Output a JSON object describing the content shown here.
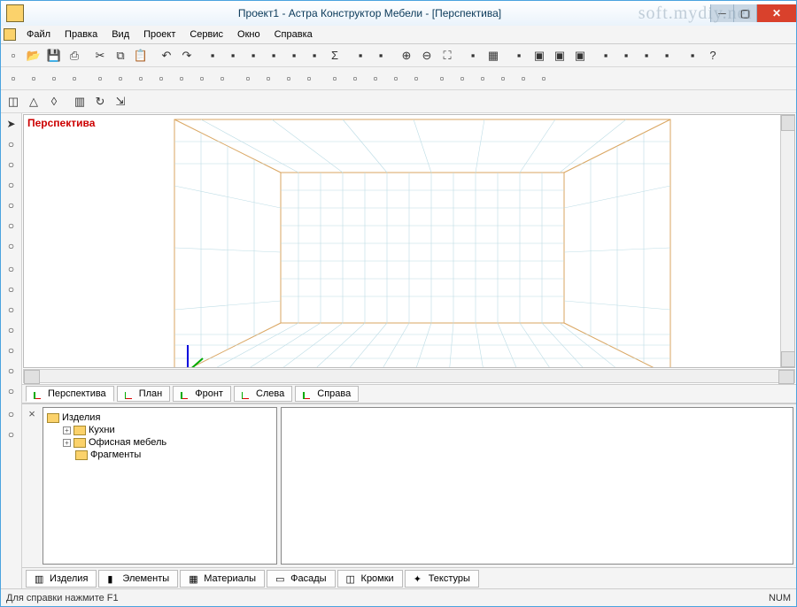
{
  "title": "Проект1 - Астра Конструктор Мебели - [Перспектива]",
  "watermark": "soft.mydiy.net",
  "menu": [
    "Файл",
    "Правка",
    "Вид",
    "Проект",
    "Сервис",
    "Окно",
    "Справка"
  ],
  "viewport_label": "Перспектива",
  "view_tabs": [
    "Перспектива",
    "План",
    "Фронт",
    "Слева",
    "Справа"
  ],
  "tree": {
    "root": "Изделия",
    "children": [
      {
        "label": "Кухни",
        "expandable": true
      },
      {
        "label": "Офисная мебель",
        "expandable": true
      },
      {
        "label": "Фрагменты",
        "expandable": false
      }
    ]
  },
  "bottom_tabs": [
    "Изделия",
    "Элементы",
    "Материалы",
    "Фасады",
    "Кромки",
    "Текстуры"
  ],
  "status_left": "Для справки нажмите F1",
  "status_right": "NUM",
  "toolbar1_icons": [
    "new-icon",
    "open-icon",
    "save-icon",
    "print-icon",
    "sep",
    "cut-icon",
    "copy-icon",
    "paste-icon",
    "sep",
    "undo-icon",
    "redo-icon",
    "sep",
    "item-icon",
    "item-icon",
    "item-icon",
    "item-icon",
    "item-icon",
    "item-icon",
    "sum-icon",
    "sep",
    "item-icon",
    "item-icon",
    "sep",
    "zoom-in-icon",
    "zoom-out-icon",
    "zoom-fit-icon",
    "sep",
    "item-icon",
    "grid-icon",
    "sep",
    "item-icon",
    "box-icon",
    "box-icon",
    "box-icon",
    "sep",
    "item-icon",
    "item-icon",
    "item-icon",
    "item-icon",
    "sep",
    "item-icon",
    "help-icon"
  ],
  "toolbar2_icons": [
    "t2",
    "t2",
    "t2",
    "t2",
    "sep",
    "t2",
    "t2",
    "t2",
    "t2",
    "t2",
    "t2",
    "t2",
    "sep",
    "t2",
    "t2",
    "t2",
    "t2",
    "sep",
    "t2",
    "t2",
    "t2",
    "t2",
    "t2",
    "sep",
    "t2",
    "t2",
    "t2",
    "t2",
    "t2",
    "t2"
  ],
  "toolbar3_icons": [
    "cube-icon",
    "prism-icon",
    "drop-icon",
    "sep",
    "panel-icon",
    "rot-icon",
    "ext-icon"
  ],
  "side_icons": [
    "arrow-icon",
    "i",
    "i",
    "i",
    "i",
    "i",
    "i",
    "sep",
    "i",
    "i",
    "i",
    "i",
    "i",
    "i",
    "i",
    "sep",
    "i",
    "i"
  ]
}
